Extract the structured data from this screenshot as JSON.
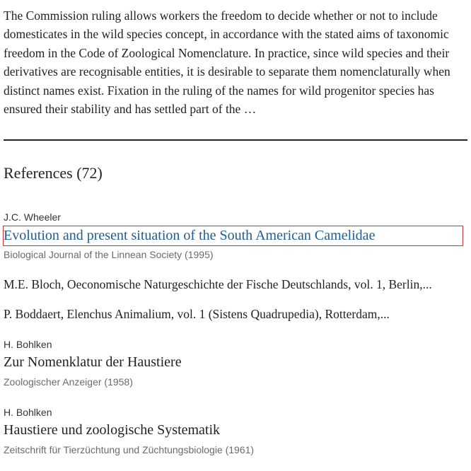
{
  "abstract": {
    "text": "The Commission ruling allows workers the freedom to decide whether or not to include domesticates in the wild species concept, in accordance with the stated aims of taxonomic freedom in the Code of Zoological Nomenclature. In practice, since wild species and their derivatives are recognisable entities, it is desirable to separate them nomenclaturally when distinct names exist. Fixation in the ruling of the names for wild progenitor species has ensured their stability and has settled part of the …"
  },
  "references": {
    "heading": "References (72)",
    "items": [
      {
        "author": "J.C. Wheeler",
        "title": "Evolution and present situation of the South American Camelidae",
        "journal": "Biological Journal of the Linnean Society (1995)"
      },
      {
        "text": "M.E. Bloch, Oeconomische Naturgeschichte der Fische Deutschlands, vol. 1, Berlin,..."
      },
      {
        "text": "P. Boddaert, Elenchus Animalium, vol. 1 (Sistens Quadrupedia), Rotterdam,..."
      },
      {
        "author": "H. Bohlken",
        "title": "Zur Nomenklatur der Haustiere",
        "journal": "Zoologischer Anzeiger (1958)"
      },
      {
        "author": "H. Bohlken",
        "title": "Haustiere und zoologische Systematik",
        "journal": "Zeitschrift für Tierzüchtung und Züchtungsbiologie (1961)"
      }
    ]
  },
  "colors": {
    "link": "#1f5c8f",
    "focus_outline": "#cc3333",
    "meta": "#6b6b6b"
  }
}
